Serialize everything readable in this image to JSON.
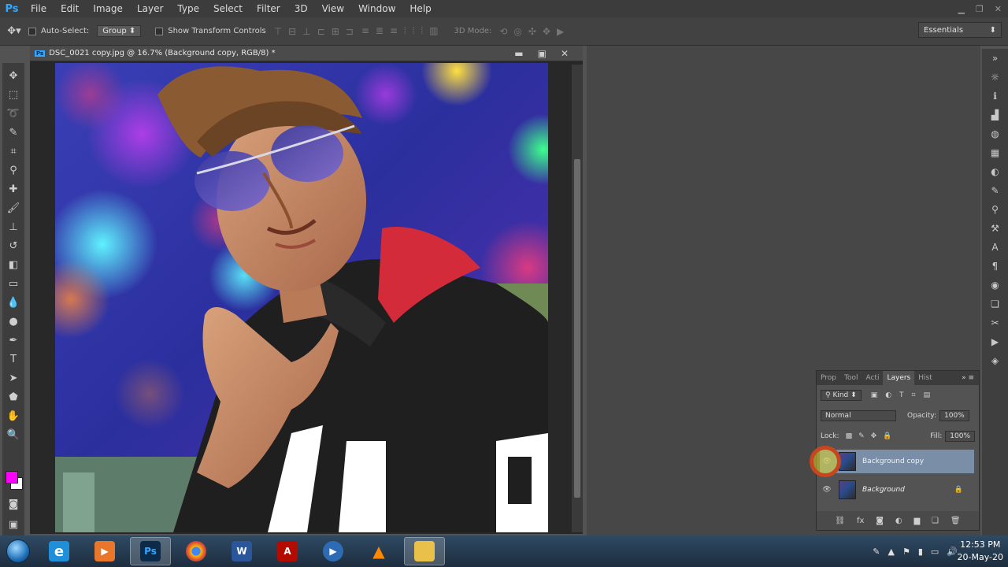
{
  "app": {
    "logo": "Ps"
  },
  "menu": [
    "File",
    "Edit",
    "Image",
    "Layer",
    "Type",
    "Select",
    "Filter",
    "3D",
    "View",
    "Window",
    "Help"
  ],
  "options": {
    "auto_select_label": "Auto-Select:",
    "auto_select_value": "Group",
    "show_transform_label": "Show Transform Controls",
    "mode_3d_label": "3D Mode:",
    "workspace": "Essentials"
  },
  "document": {
    "title": "DSC_0021 copy.jpg @ 16.7% (Background copy, RGB/8) *",
    "icon_label": "Ps"
  },
  "colors": {
    "foreground": "#ff00ff",
    "background": "#ffffff"
  },
  "layers_panel": {
    "tabs": [
      "Prop",
      "Tool",
      "Acti",
      "Layers",
      "Hist"
    ],
    "active_tab": "Layers",
    "kind_label": "Kind",
    "blend_mode": "Normal",
    "opacity_label": "Opacity:",
    "opacity_value": "100%",
    "lock_label": "Lock:",
    "fill_label": "Fill:",
    "fill_value": "100%",
    "layers": [
      {
        "name": "Background copy",
        "selected": true
      },
      {
        "name": "Background",
        "selected": false,
        "locked": true
      }
    ]
  },
  "taskbar": {
    "time": "12:53 PM",
    "date": "20-May-20",
    "apps": [
      "internet-explorer",
      "media-player",
      "photoshop",
      "chrome",
      "word",
      "acrobat",
      "wmp",
      "vlc",
      "explorer"
    ]
  }
}
